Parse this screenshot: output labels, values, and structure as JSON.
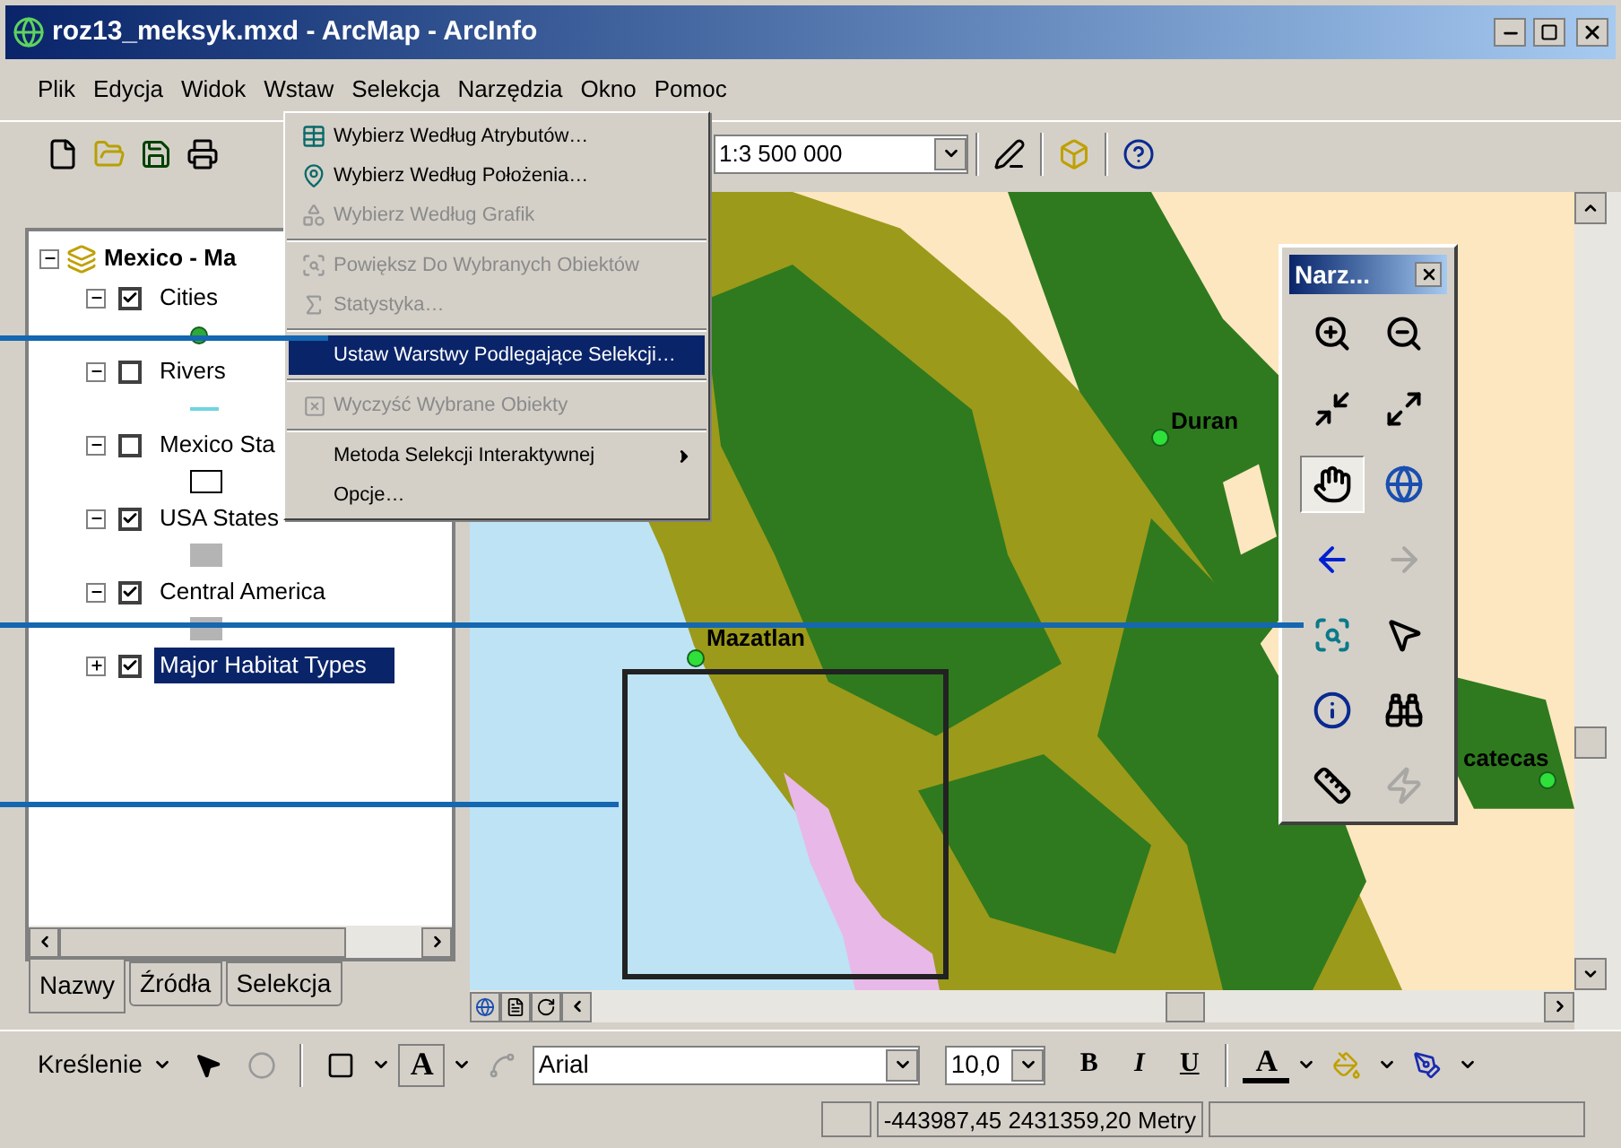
{
  "window": {
    "title": "roz13_meksyk.mxd - ArcMap - ArcInfo"
  },
  "menu_bar": [
    "Plik",
    "Edycja",
    "Widok",
    "Wstaw",
    "Selekcja",
    "Narzędzia",
    "Okno",
    "Pomoc"
  ],
  "toolbar": {
    "scale": "1:3 500 000"
  },
  "selection_menu": [
    {
      "kind": "item",
      "label": "Wybierz Według Atrybutów…",
      "disabled": false,
      "selected": false
    },
    {
      "kind": "item",
      "label": "Wybierz Według Położenia…",
      "disabled": false,
      "selected": false
    },
    {
      "kind": "item",
      "label": "Wybierz Według Grafik",
      "disabled": true,
      "selected": false
    },
    {
      "kind": "separator"
    },
    {
      "kind": "item",
      "label": "Powiększ Do Wybranych Obiektów",
      "disabled": true,
      "selected": false
    },
    {
      "kind": "item",
      "label": "Statystyka…",
      "disabled": true,
      "selected": false
    },
    {
      "kind": "separator"
    },
    {
      "kind": "item",
      "label": "Ustaw Warstwy Podlegające Selekcji…",
      "disabled": false,
      "selected": true
    },
    {
      "kind": "separator"
    },
    {
      "kind": "item",
      "label": "Wyczyść Wybrane Obiekty",
      "disabled": true,
      "selected": false
    },
    {
      "kind": "separator"
    },
    {
      "kind": "submenu",
      "label": "Metoda Selekcji Interaktywnej",
      "disabled": false,
      "selected": false
    },
    {
      "kind": "item",
      "label": "Opcje…",
      "disabled": false,
      "selected": false
    }
  ],
  "table_of_contents": {
    "root": {
      "label": "Mexico - Ma",
      "expanded": true,
      "children": [
        {
          "label": "Cities",
          "checked": true,
          "expanded": true,
          "selected": false,
          "kind": "point"
        },
        {
          "label": "Rivers",
          "checked": false,
          "expanded": true,
          "selected": false,
          "kind": "line"
        },
        {
          "label": "Mexico Sta",
          "checked": false,
          "expanded": true,
          "selected": false,
          "kind": "hollow"
        },
        {
          "label": "USA States",
          "checked": true,
          "expanded": true,
          "selected": false,
          "kind": "fill"
        },
        {
          "label": "Central America",
          "checked": true,
          "expanded": true,
          "selected": false,
          "kind": "fill"
        },
        {
          "label": "Major Habitat Types",
          "checked": true,
          "expanded": false,
          "selected": true
        }
      ]
    }
  },
  "toc_tabs": [
    {
      "label": "Nazwy",
      "selected": true
    },
    {
      "label": "Źródła",
      "selected": false
    },
    {
      "label": "Selekcja",
      "selected": false
    }
  ],
  "map": {
    "labels": [
      "Duran",
      "Mazatlan",
      "catecas"
    ]
  },
  "tools_window": {
    "title": "Narz...",
    "tools": [
      {
        "selected": false,
        "disabled": false
      },
      {
        "selected": false,
        "disabled": false
      },
      {
        "selected": false,
        "disabled": false
      },
      {
        "selected": false,
        "disabled": false
      },
      {
        "selected": true,
        "disabled": false
      },
      {
        "selected": false,
        "disabled": false
      },
      {
        "selected": false,
        "disabled": false
      },
      {
        "selected": false,
        "disabled": true
      },
      {
        "selected": false,
        "disabled": false
      },
      {
        "selected": false,
        "disabled": false
      },
      {
        "selected": false,
        "disabled": false
      },
      {
        "selected": false,
        "disabled": false
      },
      {
        "selected": false,
        "disabled": false
      },
      {
        "selected": false,
        "disabled": true
      }
    ]
  },
  "drawing_toolbar": {
    "menu": "Kreślenie",
    "text_button": "A",
    "font": "Arial",
    "font_size": "10,0",
    "bold": "B",
    "italic": "I",
    "underline": "U",
    "font_color_button": "A"
  },
  "status_bar": {
    "coordinates": "-443987,45  2431359,20 Metry"
  }
}
